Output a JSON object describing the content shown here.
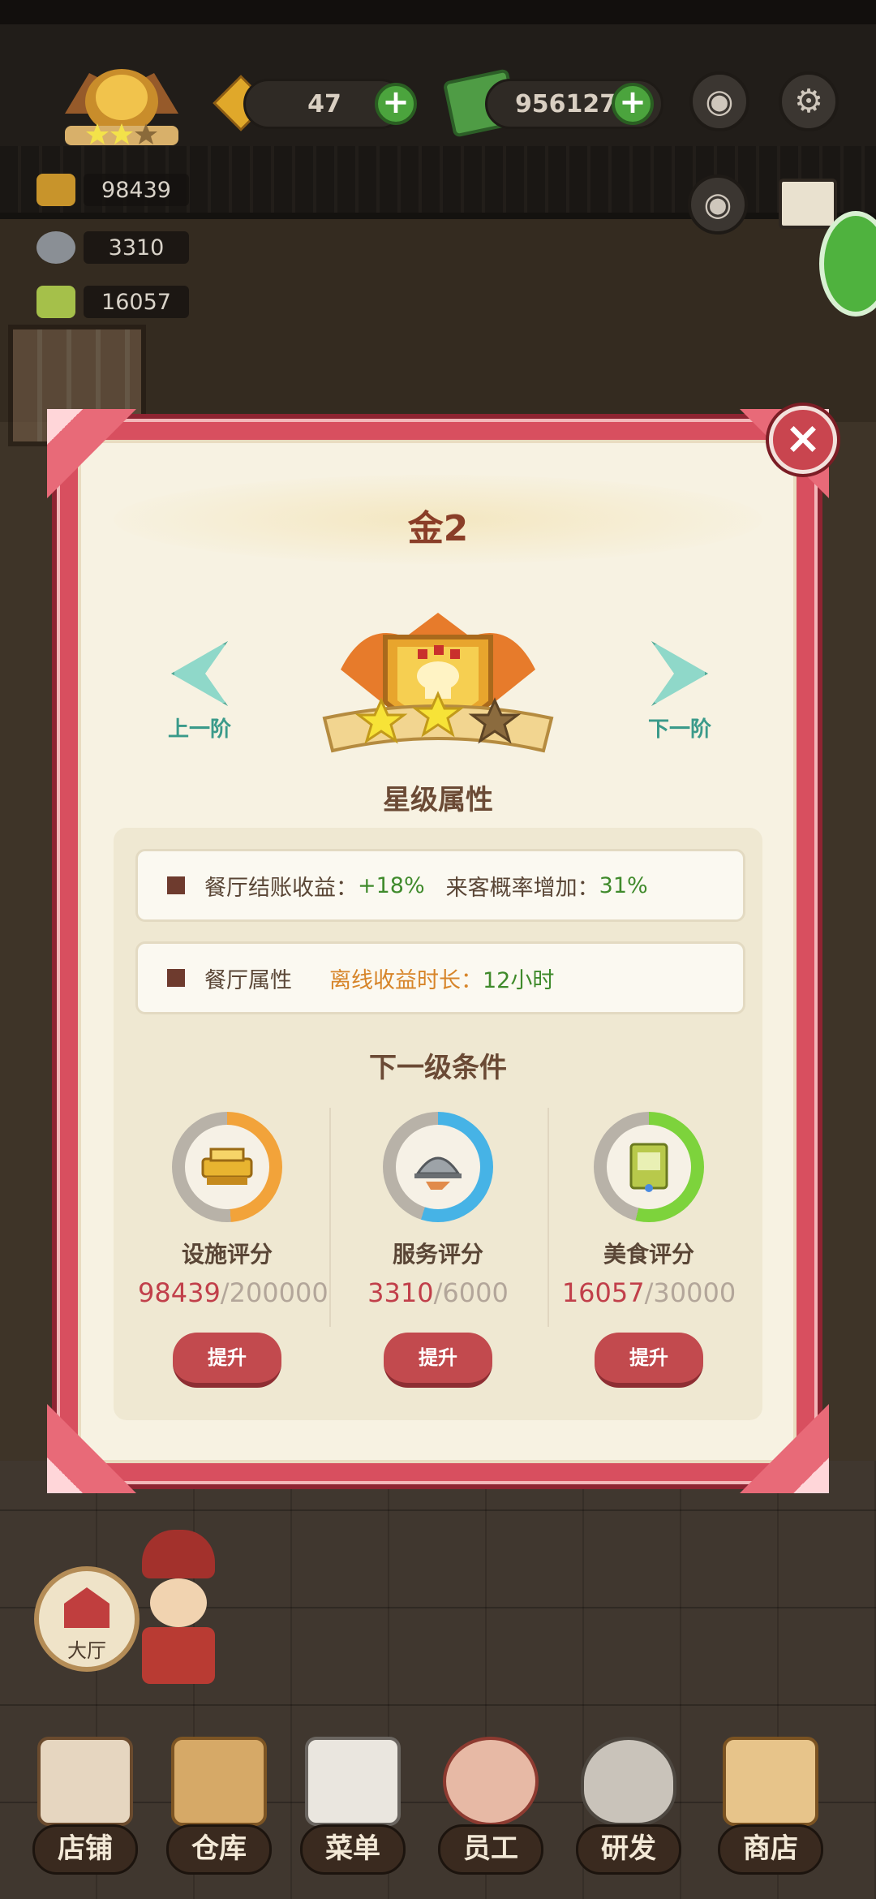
{
  "hud": {
    "gems": "47",
    "money": "9561273",
    "facility_stat": "98439",
    "service_stat": "3310",
    "food_stat": "16057",
    "camera_icon": "camera-icon",
    "settings_icon": "gear-icon"
  },
  "dialog": {
    "title": "金2",
    "prev_label": "上一阶",
    "next_label": "下一阶",
    "stars_filled": 2,
    "stars_total": 3,
    "star_section_title": "星级属性",
    "attr1_name": "餐厅结账收益",
    "attr1_sep": "：",
    "attr1_value": "+18%",
    "attr1b_name": "来客概率增加",
    "attr1b_sep": "：",
    "attr1b_value": "31%",
    "attr2_name": "餐厅属性",
    "attr2_offline_label": "离线收益时长：",
    "attr2_offline_value": "12小时",
    "next_section_title": "下一级条件",
    "conditions": [
      {
        "label": "设施评分",
        "current": "98439",
        "target": "/200000",
        "button": "提升",
        "progress": 0.49,
        "ring_color": "#f2a33a"
      },
      {
        "label": "服务评分",
        "current": "3310",
        "target": "/6000",
        "button": "提升",
        "progress": 0.55,
        "ring_color": "#46b3e6"
      },
      {
        "label": "美食评分",
        "current": "16057",
        "target": "/30000",
        "button": "提升",
        "progress": 0.54,
        "ring_color": "#7dd33c"
      }
    ]
  },
  "bottom": {
    "hall_label": "大厅",
    "nav": [
      "店铺",
      "仓库",
      "菜单",
      "员工",
      "研发",
      "商店"
    ]
  }
}
